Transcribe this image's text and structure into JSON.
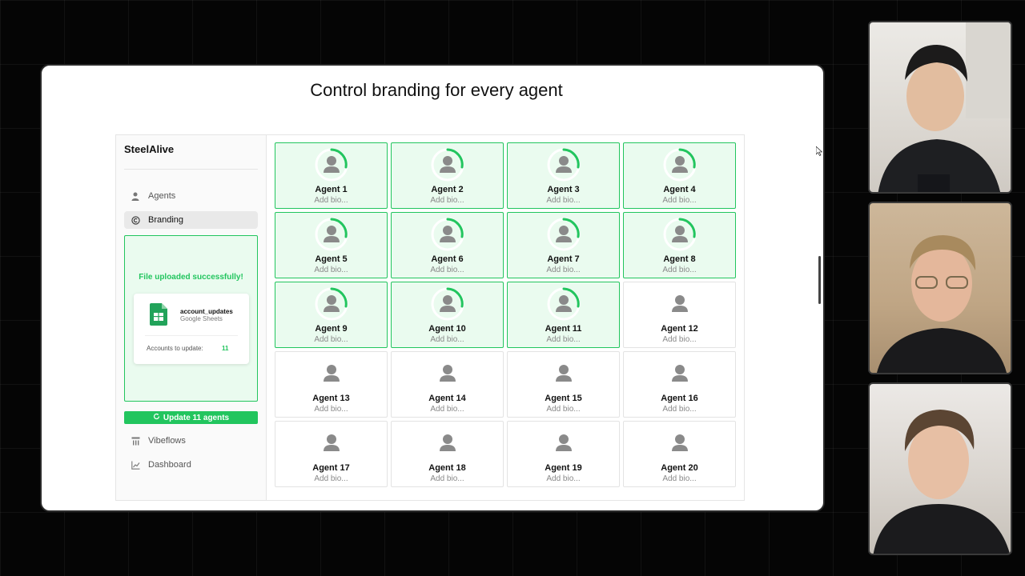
{
  "slide": {
    "title": "Control branding for every agent"
  },
  "app": {
    "brand": "SteelAlive",
    "nav": [
      {
        "label": "Agents",
        "icon": "person-icon",
        "active": false
      },
      {
        "label": "Branding",
        "icon": "copyright-icon",
        "active": true
      }
    ],
    "upload": {
      "status": "File uploaded successfully!",
      "file_name": "account_updates",
      "file_type": "Google Sheets",
      "accounts_label": "Accounts to update:",
      "accounts_count": "11"
    },
    "update_button": "Update 11 agents",
    "nav_lower": [
      {
        "label": "Vibeflows",
        "icon": "flow-icon"
      },
      {
        "label": "Dashboard",
        "icon": "chart-icon"
      }
    ]
  },
  "agents": [
    {
      "name": "Agent 1",
      "bio": "Add bio...",
      "updating": true
    },
    {
      "name": "Agent 2",
      "bio": "Add bio...",
      "updating": true
    },
    {
      "name": "Agent 3",
      "bio": "Add bio...",
      "updating": true
    },
    {
      "name": "Agent 4",
      "bio": "Add bio...",
      "updating": true
    },
    {
      "name": "Agent 5",
      "bio": "Add bio...",
      "updating": true
    },
    {
      "name": "Agent 6",
      "bio": "Add bio...",
      "updating": true
    },
    {
      "name": "Agent 7",
      "bio": "Add bio...",
      "updating": true
    },
    {
      "name": "Agent 8",
      "bio": "Add bio...",
      "updating": true
    },
    {
      "name": "Agent 9",
      "bio": "Add bio...",
      "updating": true
    },
    {
      "name": "Agent 10",
      "bio": "Add bio...",
      "updating": true
    },
    {
      "name": "Agent 11",
      "bio": "Add bio...",
      "updating": true
    },
    {
      "name": "Agent 12",
      "bio": "Add bio...",
      "updating": false
    },
    {
      "name": "Agent 13",
      "bio": "Add bio...",
      "updating": false
    },
    {
      "name": "Agent 14",
      "bio": "Add bio...",
      "updating": false
    },
    {
      "name": "Agent 15",
      "bio": "Add bio...",
      "updating": false
    },
    {
      "name": "Agent 16",
      "bio": "Add bio...",
      "updating": false
    },
    {
      "name": "Agent 17",
      "bio": "Add bio...",
      "updating": false
    },
    {
      "name": "Agent 18",
      "bio": "Add bio...",
      "updating": false
    },
    {
      "name": "Agent 19",
      "bio": "Add bio...",
      "updating": false
    },
    {
      "name": "Agent 20",
      "bio": "Add bio...",
      "updating": false
    }
  ],
  "colors": {
    "accent": "#22c55e",
    "accent_bg": "#eafbef"
  }
}
